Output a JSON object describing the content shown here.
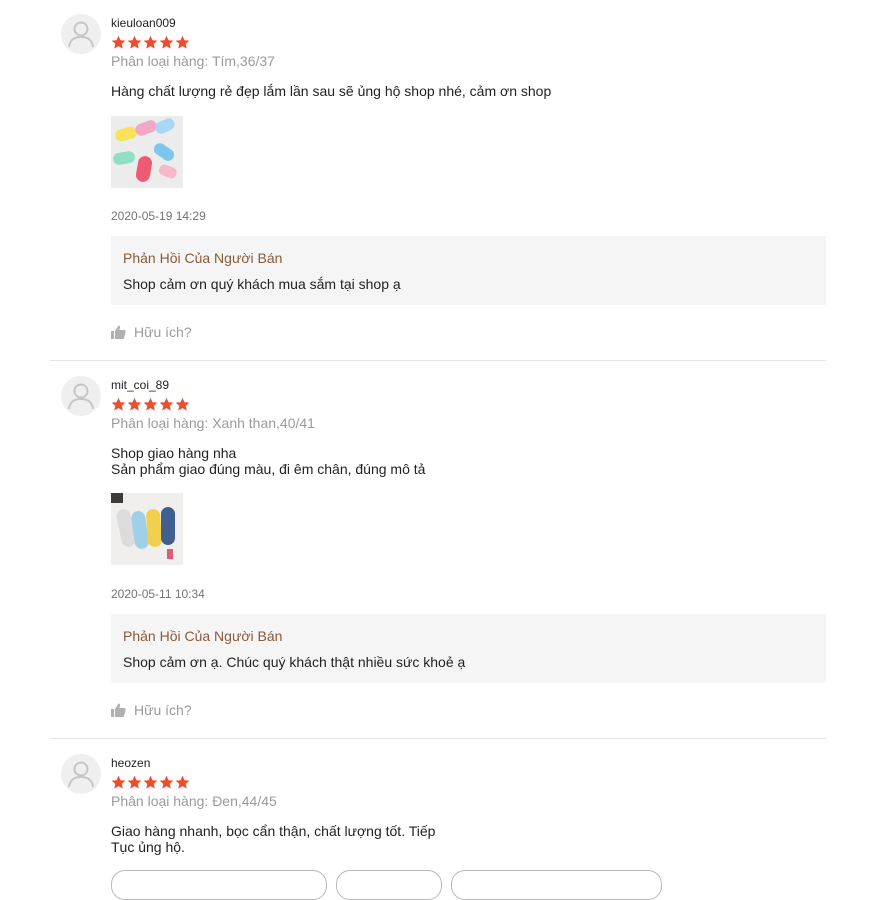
{
  "reviews": [
    {
      "username": "kieuloan009",
      "rating": 5,
      "variation": "Phân loại hàng: Tím,36/37",
      "comment": "Hàng chất lượng rẻ đẹp lắm lần sau sẽ ủng hộ shop nhé, cảm ơn shop",
      "has_photo": true,
      "photo_icon": "pastel-slippers-photo",
      "timestamp": "2020-05-19 14:29",
      "seller_reply_title": "Phản Hồi Của Người Bán",
      "seller_reply": "Shop cảm ơn quý khách mua sắm tại shop ạ",
      "helpful_label": "Hữu ích?"
    },
    {
      "username": "mit_coi_89",
      "rating": 5,
      "variation": "Phân loại hàng: Xanh than,40/41",
      "comment": "Shop giao hàng nha\nSản phẩm giao đúng màu, đi êm chân, đúng mô tả",
      "has_photo": true,
      "photo_icon": "slippers-photo",
      "timestamp": "2020-05-11 10:34",
      "seller_reply_title": "Phản Hồi Của Người Bán",
      "seller_reply": "Shop cảm ơn ạ. Chúc quý khách thật nhiều sức khoẻ ạ",
      "helpful_label": "Hữu ích?"
    },
    {
      "username": "heozen",
      "rating": 5,
      "variation": "Phân loại hàng: Đen,44/45",
      "comment": "Giao hàng nhanh, bọc cẩn thận, chất lượng tốt. Tiếp\nTục ủng hộ.",
      "has_photo": false
    }
  ],
  "colors": {
    "star": "#ee4d2d",
    "reply_title": "#8a5a3b",
    "muted_text": "#9b9b9b",
    "reply_bg": "#f5f5f5"
  },
  "icons": {
    "avatar": "user-avatar-icon",
    "star": "star-icon",
    "helpful": "thumbs-up-icon"
  }
}
